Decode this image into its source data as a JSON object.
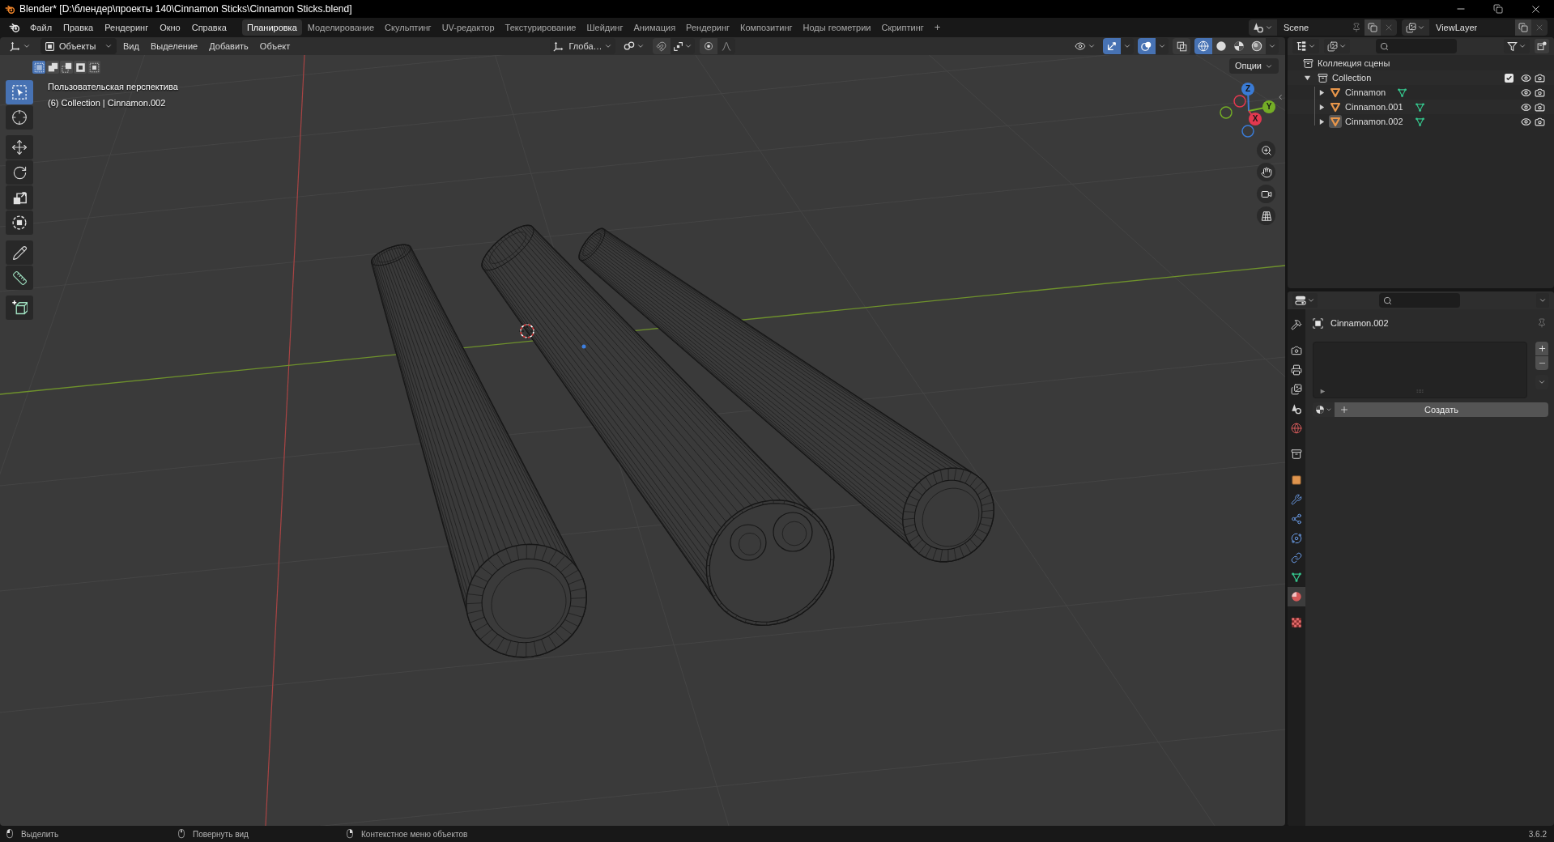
{
  "window": {
    "title": "Blender* [D:\\блендер\\проекты 140\\Cinnamon Sticks\\Cinnamon Sticks.blend]"
  },
  "menu": [
    "Файл",
    "Правка",
    "Рендеринг",
    "Окно",
    "Справка"
  ],
  "workspaces": [
    {
      "label": "Планировка",
      "selected": true
    },
    {
      "label": "Моделирование",
      "selected": false
    },
    {
      "label": "Скульптинг",
      "selected": false
    },
    {
      "label": "UV-редактор",
      "selected": false
    },
    {
      "label": "Текстурирование",
      "selected": false
    },
    {
      "label": "Шейдинг",
      "selected": false
    },
    {
      "label": "Анимация",
      "selected": false
    },
    {
      "label": "Рендеринг",
      "selected": false
    },
    {
      "label": "Композитинг",
      "selected": false
    },
    {
      "label": "Ноды геометрии",
      "selected": false
    },
    {
      "label": "Скриптинг",
      "selected": false
    }
  ],
  "add_workspace": "+",
  "scene": {
    "name": "Scene"
  },
  "view_layer": {
    "name": "ViewLayer"
  },
  "viewport": {
    "header": {
      "mode": "Объекты",
      "menus": [
        "Вид",
        "Выделение",
        "Добавить",
        "Объект"
      ],
      "orientation": "Глоба…",
      "gizmos": true,
      "overlays": true,
      "xray": false,
      "shading": [
        {
          "kind": "wireframe",
          "selected": true
        },
        {
          "kind": "solid",
          "selected": false
        },
        {
          "kind": "material",
          "selected": false
        },
        {
          "kind": "rendered",
          "selected": false
        }
      ]
    },
    "select_modes": [
      {
        "kind": "set",
        "selected": true
      },
      {
        "kind": "extend",
        "selected": false
      },
      {
        "kind": "subtract",
        "selected": false
      },
      {
        "kind": "invert",
        "selected": false
      },
      {
        "kind": "intersect",
        "selected": false
      }
    ],
    "tools": [
      {
        "kind": "select",
        "selected": true
      },
      {
        "kind": "cursor",
        "selected": false
      },
      {
        "kind": "move",
        "selected": false
      },
      {
        "kind": "rotate",
        "selected": false
      },
      {
        "kind": "scale",
        "selected": false
      },
      {
        "kind": "transform",
        "selected": false
      },
      {
        "kind": "annotate",
        "selected": false
      },
      {
        "kind": "measure",
        "selected": false
      },
      {
        "kind": "add_cube",
        "selected": false
      }
    ],
    "view_name": "Пользовательская перспектива",
    "info": "(6) Collection | Cinnamon.002",
    "options": "Опции",
    "gizmo_axes": [
      {
        "label": "Z",
        "color": "#3a7bd5"
      },
      {
        "label": "Y",
        "color": "#74ad26"
      },
      {
        "label": "X",
        "color": "#e3384f"
      }
    ]
  },
  "outliner": {
    "root": "Коллекция сцены",
    "collections": [
      {
        "label": "Collection",
        "expanded": true,
        "checked": true,
        "children": [
          {
            "label": "Cinnamon",
            "expanded": false,
            "active": false
          },
          {
            "label": "Cinnamon.001",
            "expanded": false,
            "active": false
          },
          {
            "label": "Cinnamon.002",
            "expanded": false,
            "active": true
          }
        ]
      }
    ]
  },
  "properties": {
    "tabs": [
      {
        "kind": "tool",
        "selected": false
      },
      {
        "kind": "render",
        "selected": false
      },
      {
        "kind": "output",
        "selected": false
      },
      {
        "kind": "view_layer",
        "selected": false
      },
      {
        "kind": "scene",
        "selected": false
      },
      {
        "kind": "world",
        "selected": false
      },
      {
        "kind": "collection",
        "selected": false
      },
      {
        "kind": "object",
        "selected": false
      },
      {
        "kind": "modifiers",
        "selected": false
      },
      {
        "kind": "particles",
        "selected": false
      },
      {
        "kind": "physics",
        "selected": false
      },
      {
        "kind": "constraints",
        "selected": false
      },
      {
        "kind": "data",
        "selected": false
      },
      {
        "kind": "material",
        "selected": true
      },
      {
        "kind": "texture",
        "selected": false
      }
    ],
    "object_name": "Cinnamon.002",
    "new_button": "Создать"
  },
  "status_bar": {
    "hints": [
      {
        "kind": "left",
        "label": "Выделить"
      },
      {
        "kind": "middle",
        "label": "Повернуть вид"
      },
      {
        "kind": "right",
        "label": "Контекстное меню объектов"
      }
    ],
    "version": "3.6.2"
  }
}
